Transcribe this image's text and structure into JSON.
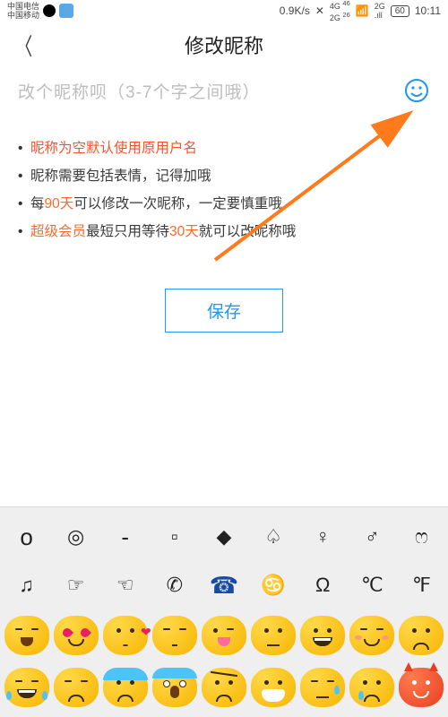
{
  "status": {
    "carrier1": "中国电信",
    "carrier2": "中国移动",
    "speed": "0.9K/s",
    "net1": "4G",
    "net2": "2G",
    "sub1": "46",
    "sub2": "26",
    "battery": "60",
    "time": "10:11"
  },
  "header": {
    "title": "修改昵称"
  },
  "input": {
    "placeholder": "改个昵称呗（3-7个字之间哦）"
  },
  "rules": {
    "r1": "昵称为空默认使用原用户名",
    "r2a": "昵称需要包括表情，记得加哦",
    "r3a": "每",
    "r3b": "90天",
    "r3c": "可以修改一次昵称，一定要慎重哦",
    "r4a": "超级会员",
    "r4b": "最短只用等待",
    "r4c": "30天",
    "r4d": "就可以改昵称哦"
  },
  "save_label": "保存",
  "symbols": {
    "row1": [
      "o",
      "◎",
      "-",
      "▫",
      "◆",
      "♤",
      "♀",
      "♂",
      "ෆ"
    ],
    "row2": [
      "♫",
      "☞",
      "☜",
      "✆",
      "☎",
      "♋",
      "Ω",
      "℃",
      "℉"
    ]
  }
}
